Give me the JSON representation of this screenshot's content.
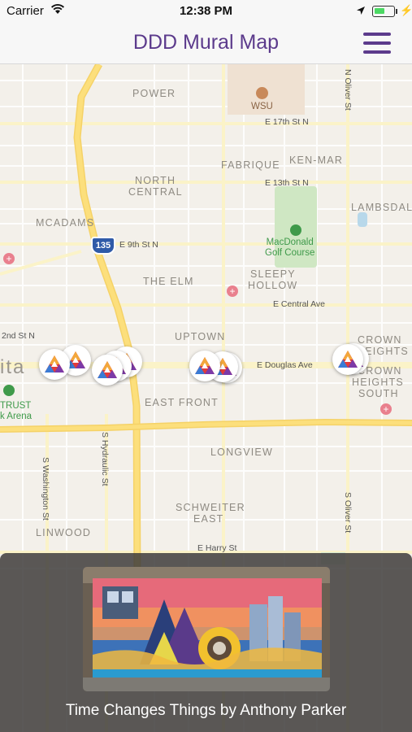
{
  "status_bar": {
    "carrier": "Carrier",
    "time": "12:38 PM",
    "battery_fraction": 0.55
  },
  "nav": {
    "title": "DDD Mural Map",
    "menu_icon": "hamburger-menu-icon"
  },
  "map": {
    "neighborhoods": [
      "POWER",
      "FABRIQUE",
      "KEN-MAR",
      "NORTH",
      "CENTRAL",
      "LAMBSDAL",
      "MCADAMS",
      "THE ELM",
      "SLEEPY",
      "HOLLOW",
      "UPTOWN",
      "CROWN",
      "HEIGHTS",
      "CROWN",
      "HEIGHTS",
      "SOUTH",
      "EAST FRONT",
      "LONGVIEW",
      "SCHWEITER",
      "EAST",
      "LINWOOD",
      "ita"
    ],
    "streets": [
      "E 17th St N",
      "E 13th St N",
      "E 9th St N",
      "E Central Ave",
      "E Douglas Ave",
      "2nd St N",
      "S Washington St",
      "S Hydraulic St",
      "E Harry St",
      "N Oliver St",
      "S Oliver St"
    ],
    "pois": {
      "university": "WSU",
      "golf_course": "MacDonald\nGolf Course",
      "arena": "TRUST\nk Arena"
    },
    "highway_shield": "135"
  },
  "selected_mural": {
    "caption": "Time Changes Things by Anthony Parker"
  }
}
